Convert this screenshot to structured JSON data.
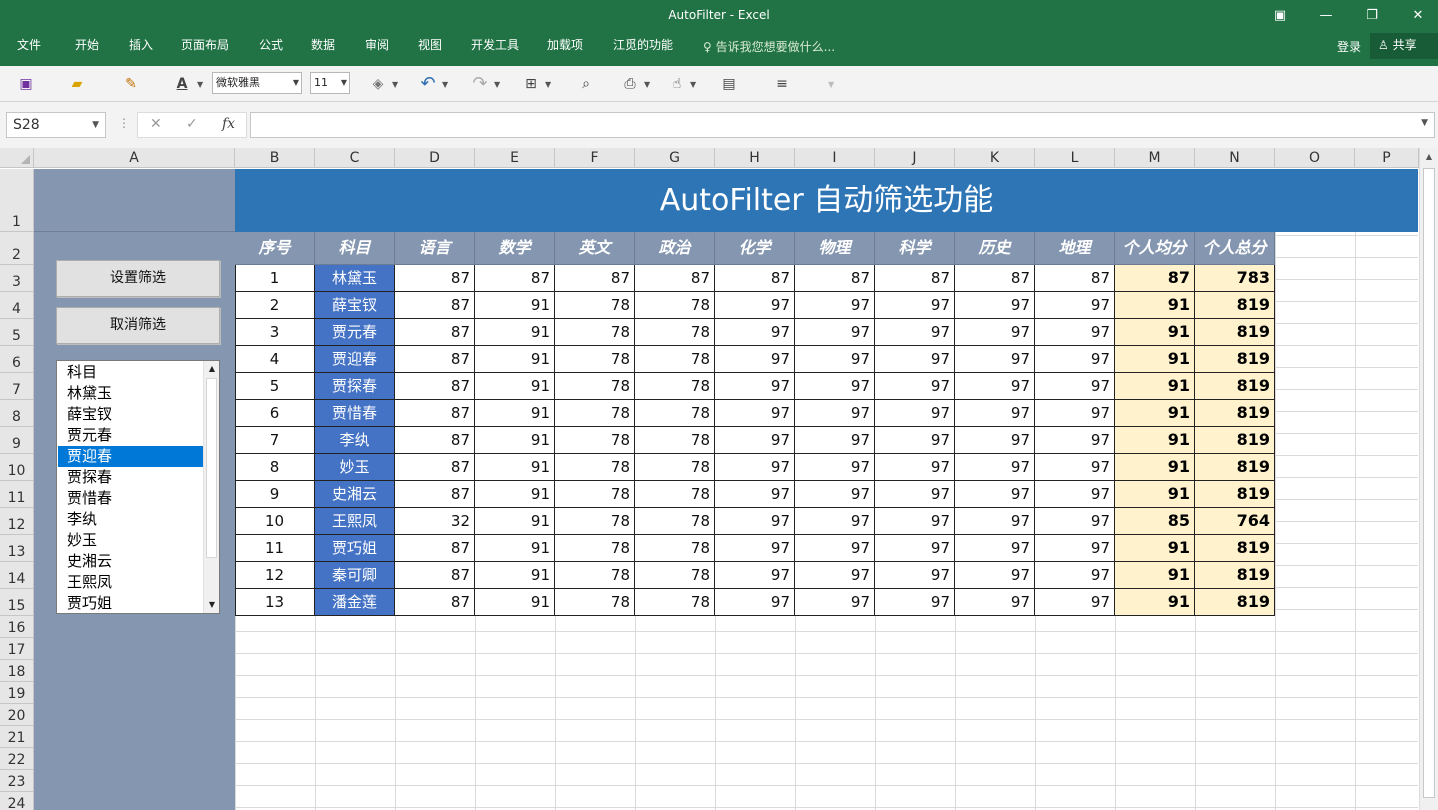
{
  "window": {
    "title": "AutoFilter - Excel"
  },
  "menu": {
    "items": [
      "文件",
      "开始",
      "插入",
      "页面布局",
      "公式",
      "数据",
      "审阅",
      "视图",
      "开发工具",
      "加载项",
      "江觅的功能"
    ],
    "tell_me": "告诉我您想要做什么...",
    "login": "登录",
    "share": "共享"
  },
  "toolbar": {
    "font_name": "微软雅黑",
    "font_size": "11"
  },
  "formula_bar": {
    "name_box": "S28",
    "fx": "fx",
    "content": ""
  },
  "columns": [
    "A",
    "B",
    "C",
    "D",
    "E",
    "F",
    "G",
    "H",
    "I",
    "J",
    "K",
    "L",
    "M",
    "N",
    "O",
    "P"
  ],
  "rows": [
    "1",
    "2",
    "3",
    "4",
    "5",
    "6",
    "7",
    "8",
    "9",
    "10",
    "11",
    "12",
    "13",
    "14",
    "15",
    "16",
    "17",
    "18",
    "19",
    "20",
    "21",
    "22",
    "23",
    "24"
  ],
  "sheet": {
    "banner": "AutoFilter 自动筛选功能",
    "headers": [
      "序号",
      "科目",
      "语言",
      "数学",
      "英文",
      "政治",
      "化学",
      "物理",
      "科学",
      "历史",
      "地理",
      "个人均分",
      "个人总分"
    ],
    "data": [
      [
        "1",
        "林黛玉",
        "87",
        "87",
        "87",
        "87",
        "87",
        "87",
        "87",
        "87",
        "87",
        "87",
        "783"
      ],
      [
        "2",
        "薛宝钗",
        "87",
        "91",
        "78",
        "78",
        "97",
        "97",
        "97",
        "97",
        "97",
        "91",
        "819"
      ],
      [
        "3",
        "贾元春",
        "87",
        "91",
        "78",
        "78",
        "97",
        "97",
        "97",
        "97",
        "97",
        "91",
        "819"
      ],
      [
        "4",
        "贾迎春",
        "87",
        "91",
        "78",
        "78",
        "97",
        "97",
        "97",
        "97",
        "97",
        "91",
        "819"
      ],
      [
        "5",
        "贾探春",
        "87",
        "91",
        "78",
        "78",
        "97",
        "97",
        "97",
        "97",
        "97",
        "91",
        "819"
      ],
      [
        "6",
        "贾惜春",
        "87",
        "91",
        "78",
        "78",
        "97",
        "97",
        "97",
        "97",
        "97",
        "91",
        "819"
      ],
      [
        "7",
        "李纨",
        "87",
        "91",
        "78",
        "78",
        "97",
        "97",
        "97",
        "97",
        "97",
        "91",
        "819"
      ],
      [
        "8",
        "妙玉",
        "87",
        "91",
        "78",
        "78",
        "97",
        "97",
        "97",
        "97",
        "97",
        "91",
        "819"
      ],
      [
        "9",
        "史湘云",
        "87",
        "91",
        "78",
        "78",
        "97",
        "97",
        "97",
        "97",
        "97",
        "91",
        "819"
      ],
      [
        "10",
        "王熙凤",
        "32",
        "91",
        "78",
        "78",
        "97",
        "97",
        "97",
        "97",
        "97",
        "85",
        "764"
      ],
      [
        "11",
        "贾巧姐",
        "87",
        "91",
        "78",
        "78",
        "97",
        "97",
        "97",
        "97",
        "97",
        "91",
        "819"
      ],
      [
        "12",
        "秦可卿",
        "87",
        "91",
        "78",
        "78",
        "97",
        "97",
        "97",
        "97",
        "97",
        "91",
        "819"
      ],
      [
        "13",
        "潘金莲",
        "87",
        "91",
        "78",
        "78",
        "97",
        "97",
        "97",
        "97",
        "97",
        "91",
        "819"
      ]
    ],
    "buttons": {
      "set_filter": "设置筛选",
      "cancel_filter": "取消筛选"
    },
    "listbox": {
      "items": [
        "科目",
        "林黛玉",
        "薛宝钗",
        "贾元春",
        "贾迎春",
        "贾探春",
        "贾惜春",
        "李纨",
        "妙玉",
        "史湘云",
        "王熙凤",
        "贾巧姐"
      ],
      "selected_index": 4
    }
  },
  "colors": {
    "ribbon": "#217346",
    "banner": "#2e75b6",
    "header": "#8496b0",
    "name_cell": "#4472c4",
    "calc_cell": "#fff2cc",
    "selection": "#0078d7"
  }
}
